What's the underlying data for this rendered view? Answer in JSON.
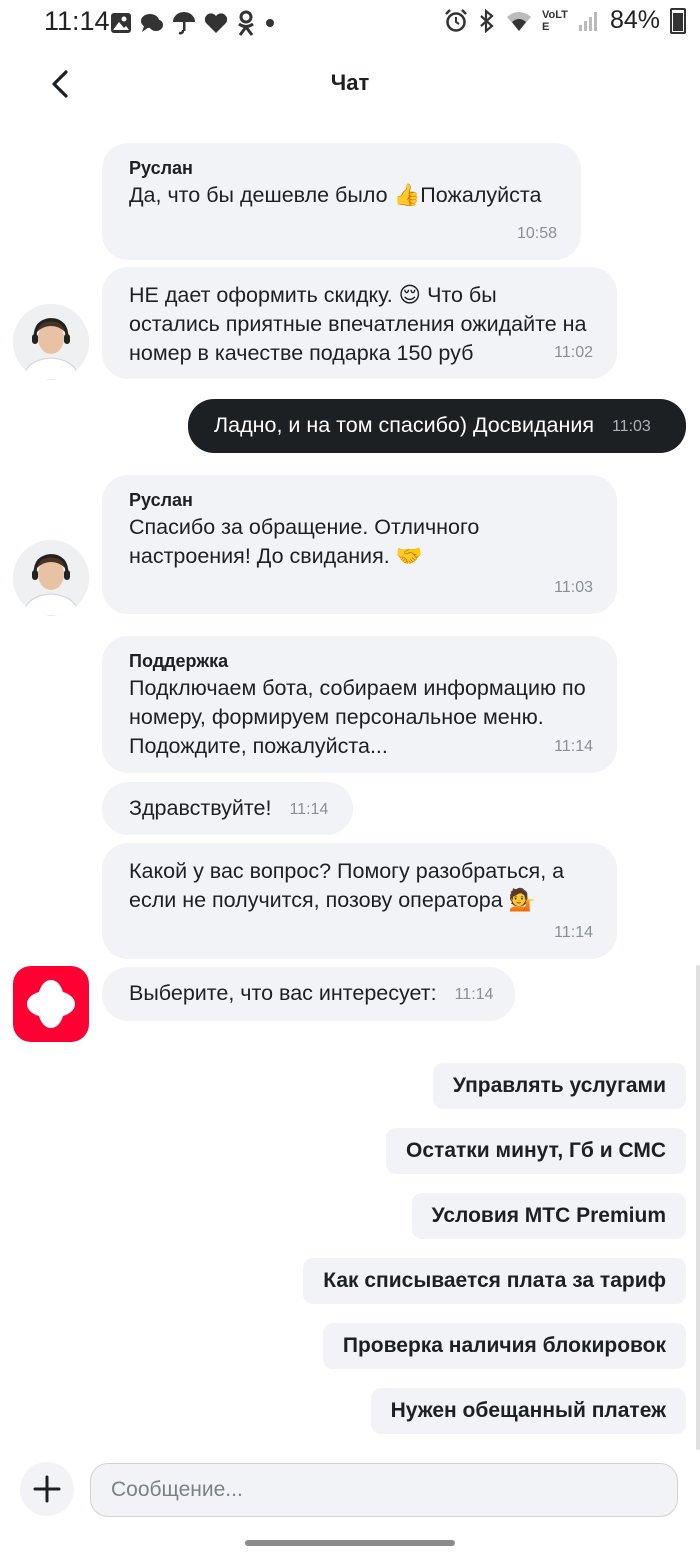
{
  "status_bar": {
    "time": "11:14",
    "battery_percent": "84%",
    "left_icons": [
      "gallery-icon",
      "chat-icon",
      "umbrella-icon",
      "heart-icon",
      "odnoklassniki-icon",
      "dot-icon"
    ],
    "right_icons": [
      "alarm-icon",
      "bluetooth-icon",
      "wifi-icon",
      "volte-icon",
      "signal-icon",
      "battery-icon"
    ],
    "volte_label": "VoLTE"
  },
  "header": {
    "title": "Чат",
    "back_icon": "chevron-left-icon"
  },
  "messages": [
    {
      "sender": "Руслан",
      "text": "Да, что бы дешевле было 👍Пожалуйста",
      "time": "10:58"
    },
    {
      "text": "НЕ дает оформить скидку. 😌 Что бы остались приятные впечатления ожидайте на номер в качестве подарка 150 руб",
      "time": "11:02"
    },
    {
      "text": "Ладно, и на том спасибо) Досвидания",
      "time": "11:03",
      "own": true
    },
    {
      "sender": "Руслан",
      "text": "Спасибо за обращение. Отличного настроения!  До свидания.  🤝",
      "time": "11:03"
    },
    {
      "sender": "Поддержка",
      "text": "Подключаем бота, собираем информацию по номеру, формируем персональное меню. Подождите, пожалуйста...",
      "time": "11:14"
    },
    {
      "text": "Здравствуйте!",
      "time": "11:14"
    },
    {
      "text": "Какой у вас вопрос? Помогу разобраться, а если не получится, позову оператора 💁",
      "time": "11:14"
    },
    {
      "text": "Выберите, что вас интересует:",
      "time": "11:14"
    }
  ],
  "quick_replies": [
    "Управлять услугами",
    "Остатки минут, Гб и СМС",
    "Условия МТС Premium",
    "Как списывается плата за тариф",
    "Проверка наличия блокировок",
    "Нужен обещанный платеж"
  ],
  "composer": {
    "placeholder": "Сообщение...",
    "value": "",
    "add_icon": "plus-icon"
  },
  "colors": {
    "bubble": "#f2f3f7",
    "own_bubble": "#1d2023",
    "brand": "#ff0032",
    "text": "#1d2023",
    "time": "#8a8f96"
  }
}
